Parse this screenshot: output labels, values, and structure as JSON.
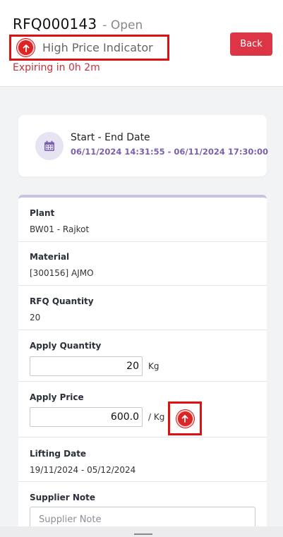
{
  "header": {
    "rfq_number": "RFQ000143",
    "status": "- Open",
    "indicator_label": "High Price Indicator",
    "expiring": "Expiring in 0h 2m",
    "back_label": "Back"
  },
  "date_card": {
    "title": "Start - End Date",
    "value": "06/11/2024 14:31:55 - 06/11/2024 17:30:00"
  },
  "fields": {
    "plant": {
      "label": "Plant",
      "value": "BW01 - Rajkot"
    },
    "material": {
      "label": "Material",
      "value": "[300156] AJMO"
    },
    "rfq_quantity": {
      "label": "RFQ Quantity",
      "value": "20"
    },
    "apply_quantity": {
      "label": "Apply Quantity",
      "value": "20",
      "unit": "Kg"
    },
    "apply_price": {
      "label": "Apply Price",
      "value": "600.0",
      "unit": "/ Kg"
    },
    "lifting_date": {
      "label": "Lifting Date",
      "value": "19/11/2024 - 05/12/2024"
    },
    "supplier_note": {
      "label": "Supplier Note",
      "placeholder": "Supplier Note"
    }
  },
  "colors": {
    "primary_red": "#dc3545",
    "accent_purple": "#7b5fb0",
    "highlight_box": "#e01010"
  },
  "icons": {
    "indicator": "arrow-up-circle-icon",
    "calendar": "calendar-icon"
  }
}
